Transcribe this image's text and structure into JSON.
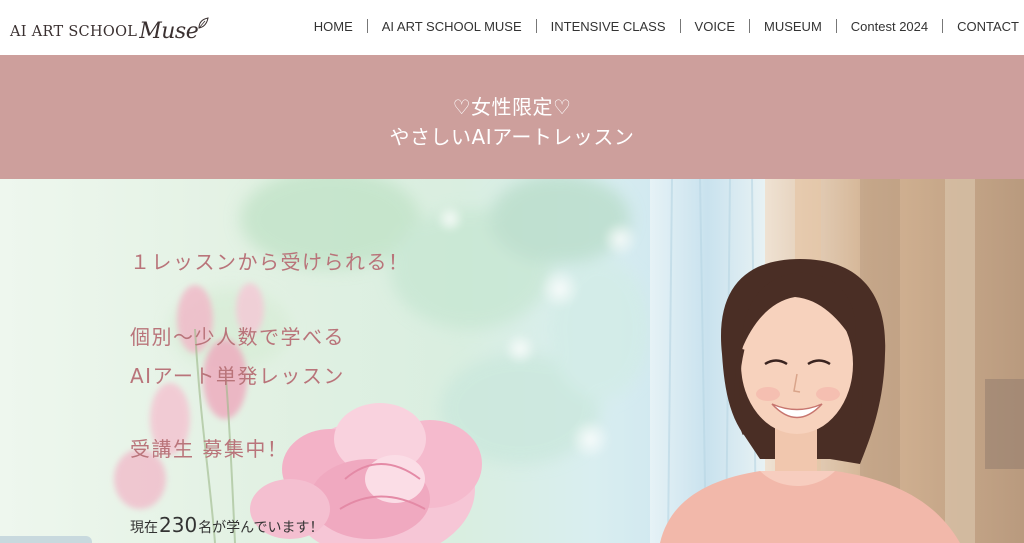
{
  "header": {
    "logo_text": "AI ART SCHOOL",
    "logo_script": "Muse",
    "nav": [
      {
        "label": "HOME"
      },
      {
        "label": "AI ART SCHOOL MUSE"
      },
      {
        "label": "INTENSIVE CLASS"
      },
      {
        "label": "VOICE"
      },
      {
        "label": "MUSEUM"
      },
      {
        "label": "Contest 2024"
      },
      {
        "label": "CONTACT"
      }
    ]
  },
  "banner": {
    "line1": "♡女性限定♡",
    "line2": "やさしいAIアートレッスン"
  },
  "hero": {
    "line1": "１レッスンから受けられる！",
    "line2": "個別〜少人数で学べる",
    "line3": "AIアート単発レッスン",
    "line4": "受講生 募集中！",
    "students_prefix": "現在",
    "students_count": "230",
    "students_suffix": "名が学んでいます！"
  },
  "colors": {
    "banner_bg": "#cd9f9c",
    "hero_accent_text": "#b9747a",
    "banner_text": "#ffffff"
  },
  "icons": {
    "logo_leaf": "leaf-icon"
  }
}
